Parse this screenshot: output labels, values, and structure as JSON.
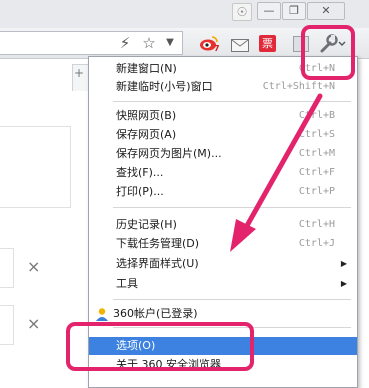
{
  "toolbar": {
    "icons": [
      "shirt-icon",
      "minimize-icon",
      "restore-icon",
      "close-icon",
      "lightning-icon",
      "star-icon",
      "dropdown-icon",
      "weibo-icon",
      "mail-icon",
      "ticket-icon",
      "tools-icon"
    ],
    "ticket_label": "票",
    "page_plus": "+",
    "page_close": "×"
  },
  "menu": {
    "items": [
      {
        "label": "新建窗口(N)",
        "shortcut": "Ctrl+N"
      },
      {
        "label": "新建临时(小号)窗口",
        "shortcut": "Ctrl+Shift+N"
      },
      {
        "label": "快照网页(B)",
        "shortcut": "Ctrl+B"
      },
      {
        "label": "保存网页(A)",
        "shortcut": "Ctrl+S"
      },
      {
        "label": "保存网页为图片(M)...",
        "shortcut": "Ctrl+M"
      },
      {
        "label": "查找(F)...",
        "shortcut": "Ctrl+F"
      },
      {
        "label": "打印(P)...",
        "shortcut": "Ctrl+P"
      },
      {
        "label": "历史记录(H)",
        "shortcut": "Ctrl+H"
      },
      {
        "label": "下载任务管理(D)",
        "shortcut": "Ctrl+J"
      },
      {
        "label": "选择界面样式(U)",
        "shortcut": ""
      },
      {
        "label": "工具",
        "shortcut": ""
      },
      {
        "label": "360帐户(已登录)",
        "shortcut": ""
      },
      {
        "label": "选项(O)",
        "shortcut": ""
      },
      {
        "label": "关于 360 安全浏览器",
        "shortcut": ""
      }
    ]
  },
  "colors": {
    "highlight": "#3d82e1",
    "annotation": "#e3246c"
  }
}
